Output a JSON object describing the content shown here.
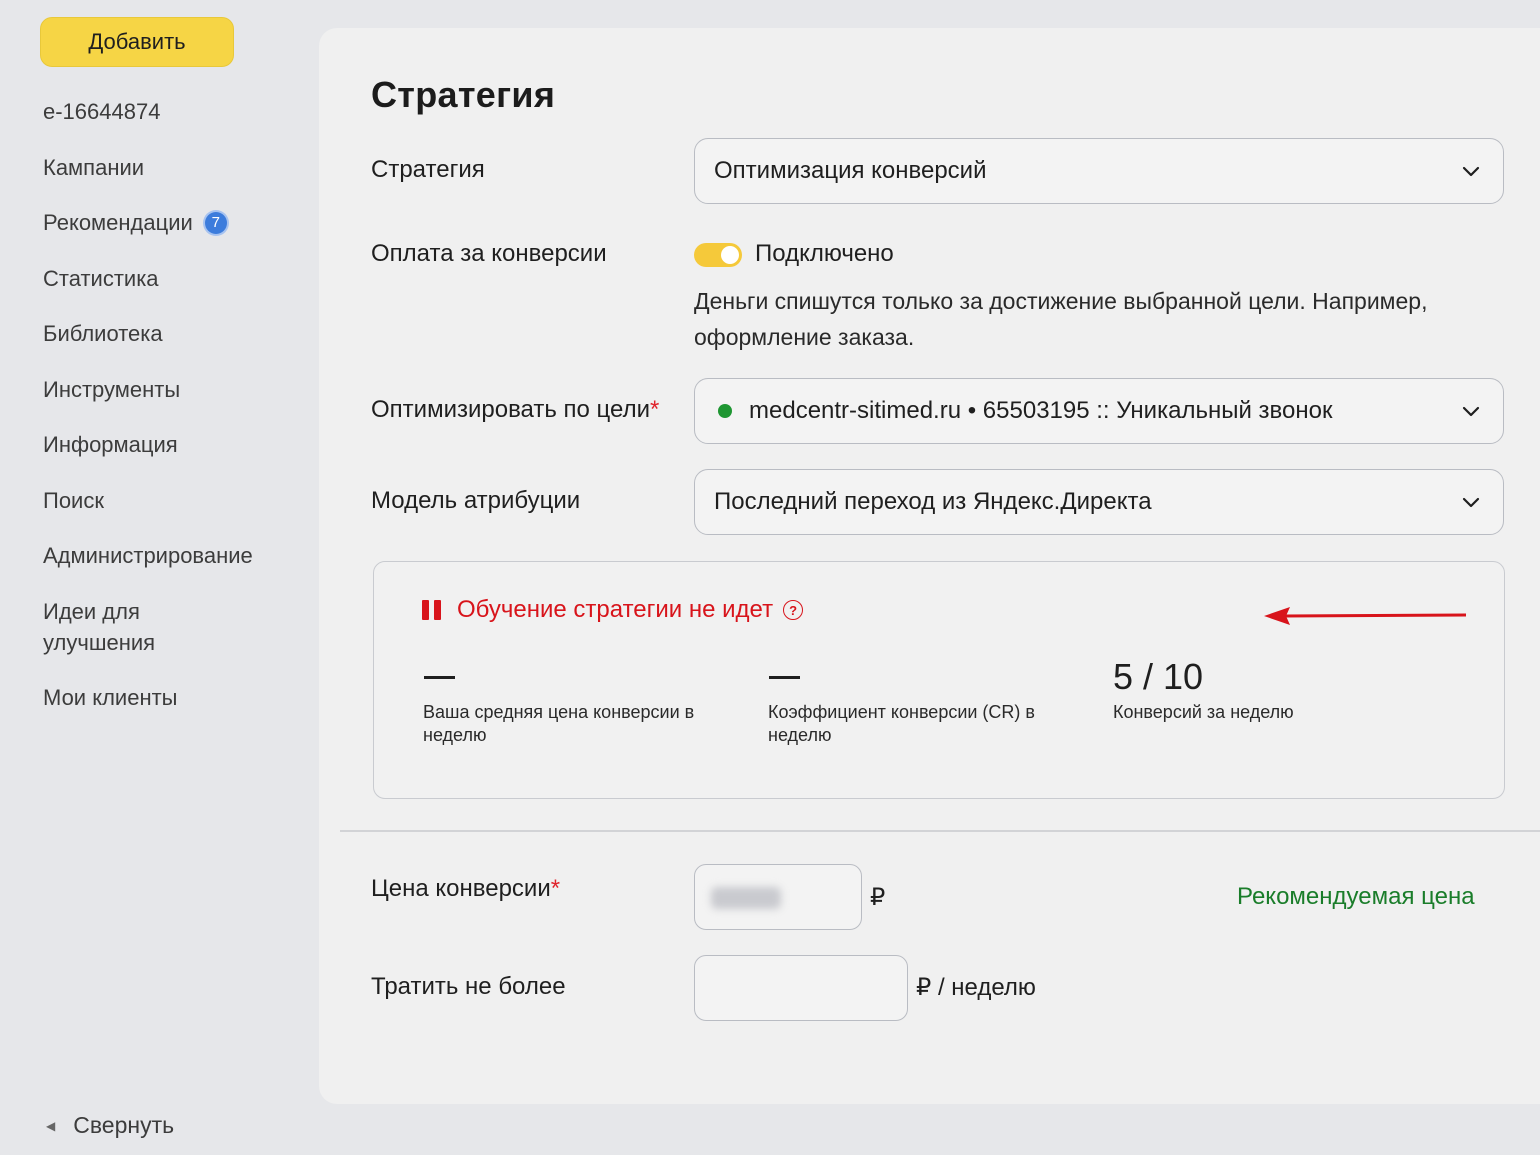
{
  "sidebar": {
    "add_label": "Добавить",
    "account": "e-16644874",
    "items": [
      {
        "label": "Кампании"
      },
      {
        "label": "Рекомендации",
        "badge": "7"
      },
      {
        "label": "Статистика"
      },
      {
        "label": "Библиотека"
      },
      {
        "label": "Инструменты"
      },
      {
        "label": "Информация"
      },
      {
        "label": "Поиск"
      },
      {
        "label": "Администрирование"
      },
      {
        "label": "Идеи для улучшения"
      },
      {
        "label": "Мои клиенты"
      }
    ],
    "collapse_label": "Свернуть"
  },
  "main": {
    "title": "Стратегия",
    "strategy": {
      "label": "Стратегия",
      "value": "Оптимизация конверсий"
    },
    "pay_for_conversions": {
      "label": "Оплата за конверсии",
      "toggle_state": "Подключено",
      "enabled": true,
      "hint": "Деньги спишутся только за достижение выбранной цели. Например, оформление заказа."
    },
    "goal": {
      "label": "Оптимизировать по цели",
      "required_mark": "*",
      "value": "medcentr-sitimed.ru • 65503195 :: Уникальный звонок"
    },
    "attribution": {
      "label": "Модель атрибуции",
      "value": "Последний переход из Яндекс.Директа"
    },
    "learning": {
      "status": "Обучение стратегии не идет",
      "help": "?",
      "metrics": [
        {
          "caption": "Ваша средняя цена конверсии в неделю"
        },
        {
          "caption": "Коэффициент конверсии (CR) в неделю"
        },
        {
          "value": "5 / 10",
          "caption": "Конверсий за неделю"
        }
      ]
    },
    "conversion_price": {
      "label": "Цена конверсии",
      "required_mark": "*",
      "unit": "₽",
      "recommended_link": "Рекомендуемая цена"
    },
    "spend_limit": {
      "label": "Тратить не более",
      "unit": "₽ / неделю"
    }
  },
  "colors": {
    "accent_yellow": "#f6d545",
    "error_red": "#d8141b",
    "success_green": "#1a7d2a",
    "badge_blue": "#3c7cdc"
  }
}
